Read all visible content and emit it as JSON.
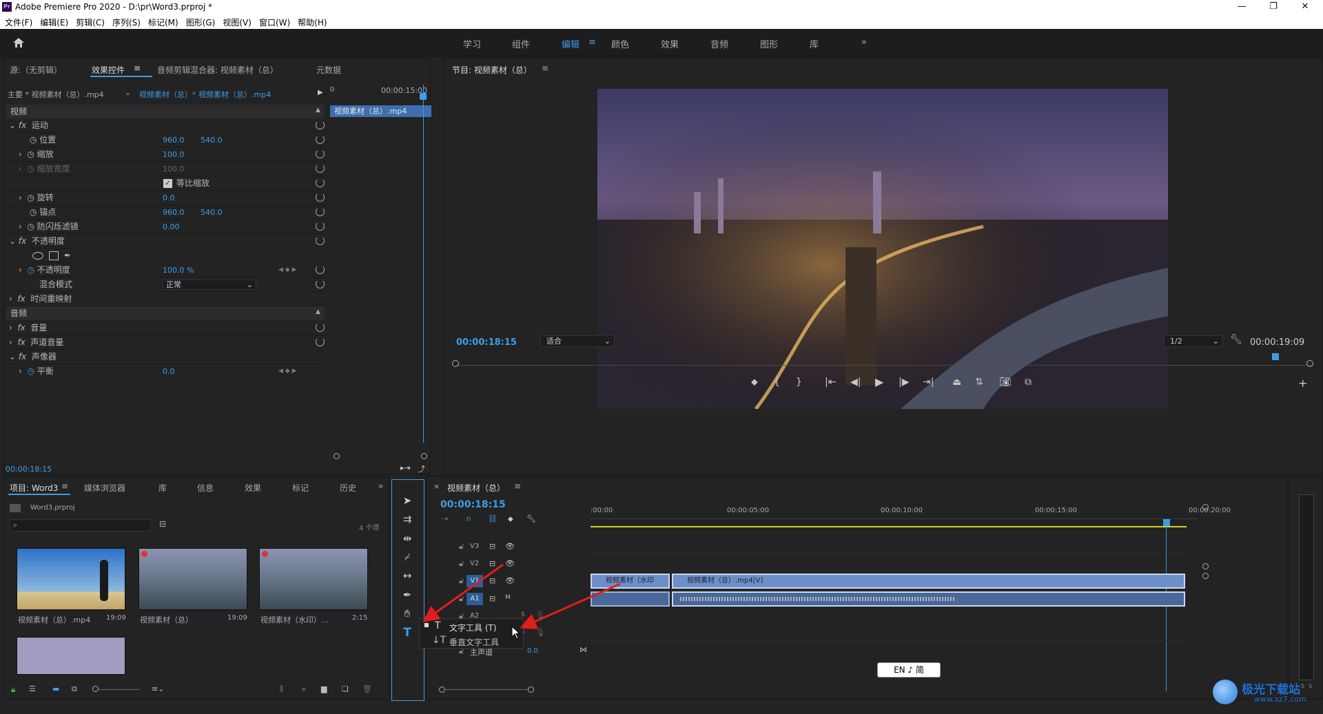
{
  "window": {
    "title": "Adobe Premiere Pro 2020 - D:\\pr\\Word3.prproj *",
    "logo": "Pr",
    "min": "—",
    "max": "❐",
    "close": "✕"
  },
  "menu": [
    "文件(F)",
    "编辑(E)",
    "剪辑(C)",
    "序列(S)",
    "标记(M)",
    "图形(G)",
    "视图(V)",
    "窗口(W)",
    "帮助(H)"
  ],
  "workspaces": {
    "items": [
      "学习",
      "组件",
      "编辑",
      "颜色",
      "效果",
      "音频",
      "图形",
      "库"
    ],
    "active": "编辑",
    "more": "»"
  },
  "effect_panel": {
    "tabs": [
      "源:（无剪辑）",
      "效果控件",
      "音频剪辑混合器: 视频素材（总）",
      "元数据"
    ],
    "header": {
      "master": "主要 * 视频素材（总）.mp4",
      "clip": "视频素材（总）* 视频素材（总）.mp4"
    },
    "timeline": {
      "start": "0",
      "end": "00:00:15:00",
      "clip": "视频素材（总）.mp4"
    },
    "video_label": "视频",
    "motion": "运动",
    "position": {
      "label": "位置",
      "x": "960.0",
      "y": "540.0"
    },
    "scale": {
      "label": "缩放",
      "v": "100.0"
    },
    "scale_width": {
      "label": "缩放宽度",
      "v": "100.0"
    },
    "uniform": "等比缩放",
    "rotation": {
      "label": "旋转",
      "v": "0.0"
    },
    "anchor": {
      "label": "锚点",
      "x": "960.0",
      "y": "540.0"
    },
    "flicker": {
      "label": "防闪烁滤镜",
      "v": "0.00"
    },
    "opacity_section": "不透明度",
    "opacity": {
      "label": "不透明度",
      "v": "100.0 %"
    },
    "blend": {
      "label": "混合模式",
      "v": "正常"
    },
    "time_remap": "时间重映射",
    "audio_label": "音频",
    "volume": "音量",
    "channel_volume": "声道音量",
    "panner": "声像器",
    "balance": {
      "label": "平衡",
      "v": "0.0"
    },
    "timecode": "00:00:18:15"
  },
  "program": {
    "title": "节目: 视频素材（总）",
    "timecode": "00:00:18:15",
    "fit": "适合",
    "quality": "1/2",
    "duration": "00:00:19:09"
  },
  "project": {
    "tabs": [
      "项目: Word3",
      "媒体浏览器",
      "库",
      "信息",
      "效果",
      "标记",
      "历史"
    ],
    "file": "Word3.prproj",
    "count": "4 个项",
    "items": [
      {
        "name": "视频素材（总）.mp4",
        "dur": "19:09"
      },
      {
        "name": "视频素材（总）",
        "dur": "19:09"
      },
      {
        "name": "视频素材（水印）...",
        "dur": "2:15"
      }
    ]
  },
  "timeline": {
    "title": "视频素材（总）",
    "timecode": "00:00:18:15",
    "ruler": [
      ":00:00",
      "00:00:05:00",
      "00:00:10:00",
      "00:00:15:00",
      "00:00:20:00"
    ],
    "tracks": {
      "v3": "V3",
      "v2": "V2",
      "v1": "V1",
      "a1": "A1",
      "a2": "A2",
      "a3": "A3",
      "master": "主声道",
      "master_val": "0.0",
      "m": "M",
      "s": "S"
    },
    "clips": {
      "c1": "视频素材（水印",
      "c2": "视频素材（总）.mp4[V]"
    }
  },
  "tool_menu": {
    "text_tool": "文字工具 (T)",
    "vertical_text_tool": "垂直文字工具"
  },
  "ime": "EN ♪ 简",
  "meter": {
    "s1": "S",
    "s2": "S"
  },
  "watermark": {
    "name": "极光下载站",
    "url": "www.xz7.com"
  }
}
